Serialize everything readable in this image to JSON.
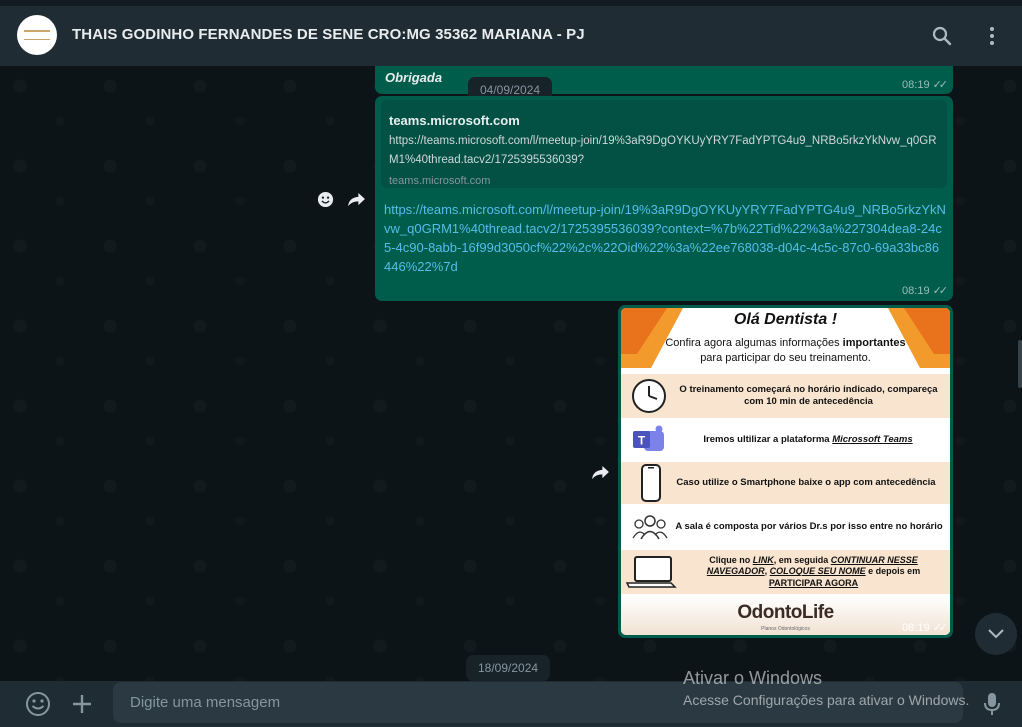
{
  "header": {
    "contact_name": "THAIS GODINHO FERNANDES DE SENE CRO:MG 35362 MARIANA - PJ",
    "icons": [
      "search-icon",
      "menu-dots-icon"
    ]
  },
  "messages": {
    "top": {
      "text": "Obrigada",
      "time": "08:19"
    },
    "date_chip_1": "04/09/2024",
    "link_msg": {
      "preview_title": "teams.microsoft.com",
      "preview_url": "https://teams.microsoft.com/l/meetup-join/19%3aR9DgOYKUyYRY7FadYPTG4u9_NRBo5rkzYkNvw_q0GRM1%40thread.tacv2/1725395536039?",
      "preview_domain": "teams.microsoft.com",
      "link_text": "https://teams.microsoft.com/l/meetup-join/19%3aR9DgOYKUyYRY7FadYPTG4u9_NRBo5rkzYkNvw_q0GRM1%40thread.tacv2/1725395536039?context=%7b%22Tid%22%3a%227304dea8-24c5-4c90-8abb-16f99d3050cf%22%2c%22Oid%22%3a%22ee768038-d04c-4c5c-87c0-69a33bc86446%22%7d",
      "time": "08:19"
    },
    "image_msg": {
      "time": "08:19",
      "flyer": {
        "title": "Olá Dentista !",
        "intro_1": "Confira agora algumas informações ",
        "intro_bold": "importantes",
        "intro_2": "para participar do seu treinamento.",
        "item_1": "O treinamento começará no horário indicado, compareça com 10 min de antecedência",
        "item_2_prefix": "Iremos ultilizar a plataforma ",
        "item_2_em": "Microssoft Teams",
        "item_3": "Caso utilize o Smartphone baixe o app com antecedência",
        "item_4": "A sala é composta por vários Dr.s por isso entre no horário",
        "item_5_a": "Clique no ",
        "item_5_link": "LINK",
        "item_5_b": ", em seguida ",
        "item_5_cont": "CONTINUAR NESSE NAVEGADOR",
        "item_5_c": ", ",
        "item_5_name": "COLOQUE SEU NOME",
        "item_5_d": " e depois em ",
        "item_5_part": "PARTICIPAR AGORA",
        "brand": "OdontoLife",
        "brand_sub": "Planos Odontológicos"
      }
    },
    "date_chip_2": "18/09/2024"
  },
  "composer": {
    "placeholder": "Digite uma mensagem",
    "icons": [
      "emoji-icon",
      "plus-icon",
      "mic-icon"
    ]
  },
  "watermark": {
    "line1": "Ativar o Windows",
    "line2": "Acesse Configurações para ativar o Windows."
  },
  "colors": {
    "outgoing_bubble": "#005c4b",
    "header_bg": "#202c33",
    "chat_bg": "#0d1418",
    "link": "#53bdeb",
    "flyer_orange": "#f39a2c"
  }
}
